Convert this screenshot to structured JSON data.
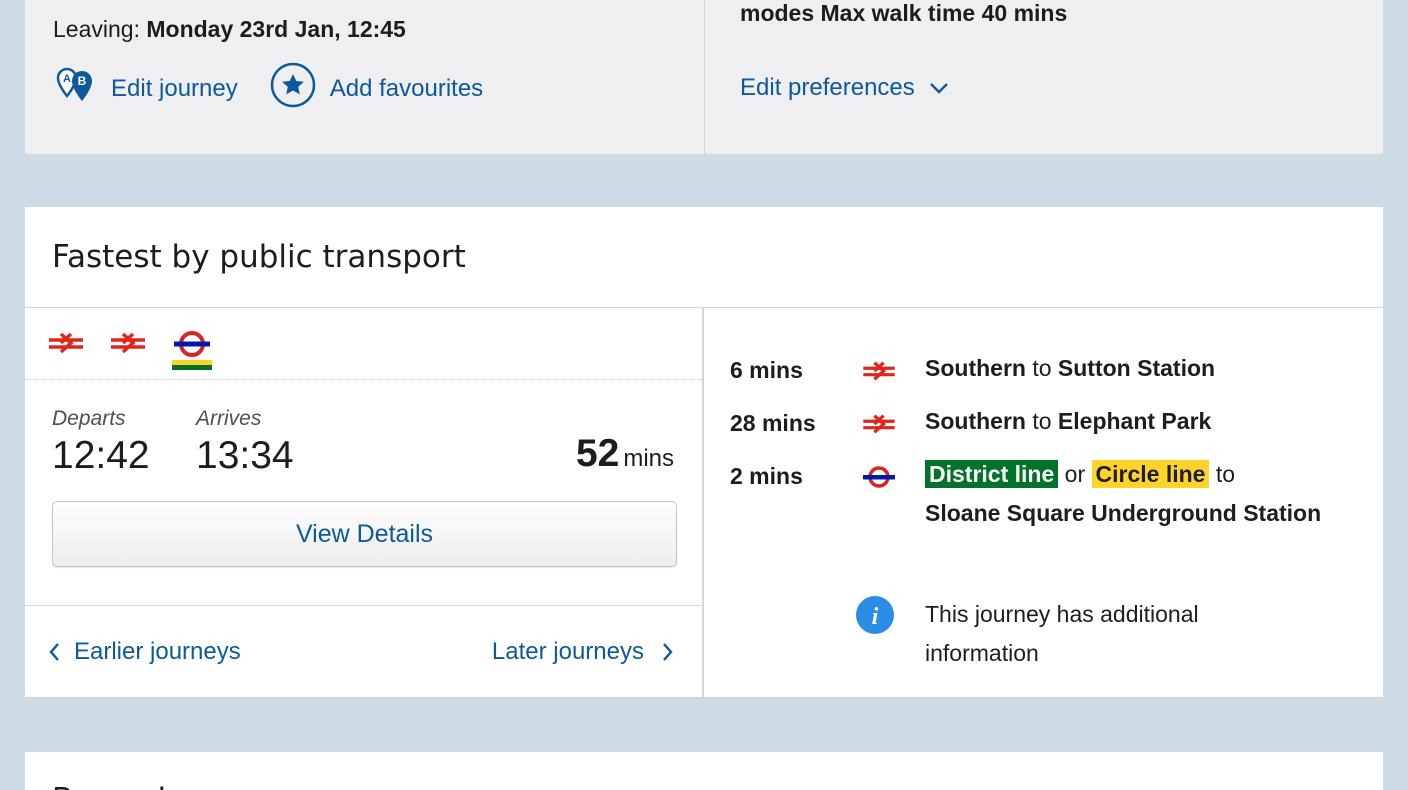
{
  "summary": {
    "leaving_label": "Leaving:",
    "leaving_value": "Monday 23rd Jan, 12:45",
    "edit_journey": "Edit journey",
    "add_favourites": "Add favourites",
    "modes_text": "modes Max walk time 40 mins",
    "edit_preferences": "Edit preferences"
  },
  "result": {
    "title": "Fastest by public transport",
    "departs_label": "Departs",
    "arrives_label": "Arrives",
    "departs_time": "12:42",
    "arrives_time": "13:34",
    "duration_value": "52",
    "duration_unit": "mins",
    "view_details": "View Details",
    "earlier": "Earlier journeys",
    "later": "Later journeys",
    "legs": [
      {
        "time": "6 mins",
        "operator": "Southern",
        "to": "to",
        "destination": "Sutton Station",
        "icon": "national-rail-icon"
      },
      {
        "time": "28 mins",
        "operator": "Southern",
        "to": "to",
        "destination": "Elephant Park",
        "icon": "national-rail-icon"
      },
      {
        "time": "2 mins",
        "line1": "District line",
        "or": "or",
        "line2": "Circle line",
        "to": "to",
        "destination": "Sloane Square Underground Station",
        "icon": "underground-roundel-icon"
      }
    ],
    "info_text": "This journey has additional information"
  },
  "next_card": {
    "title": "Bus only"
  },
  "colors": {
    "link": "#0c5a9c",
    "rail_red": "#e1251b",
    "tube_red": "#dc241f",
    "tube_blue": "#0019a8",
    "district": "#007229",
    "circle": "#ffd329",
    "info_blue": "#2a8de8"
  }
}
